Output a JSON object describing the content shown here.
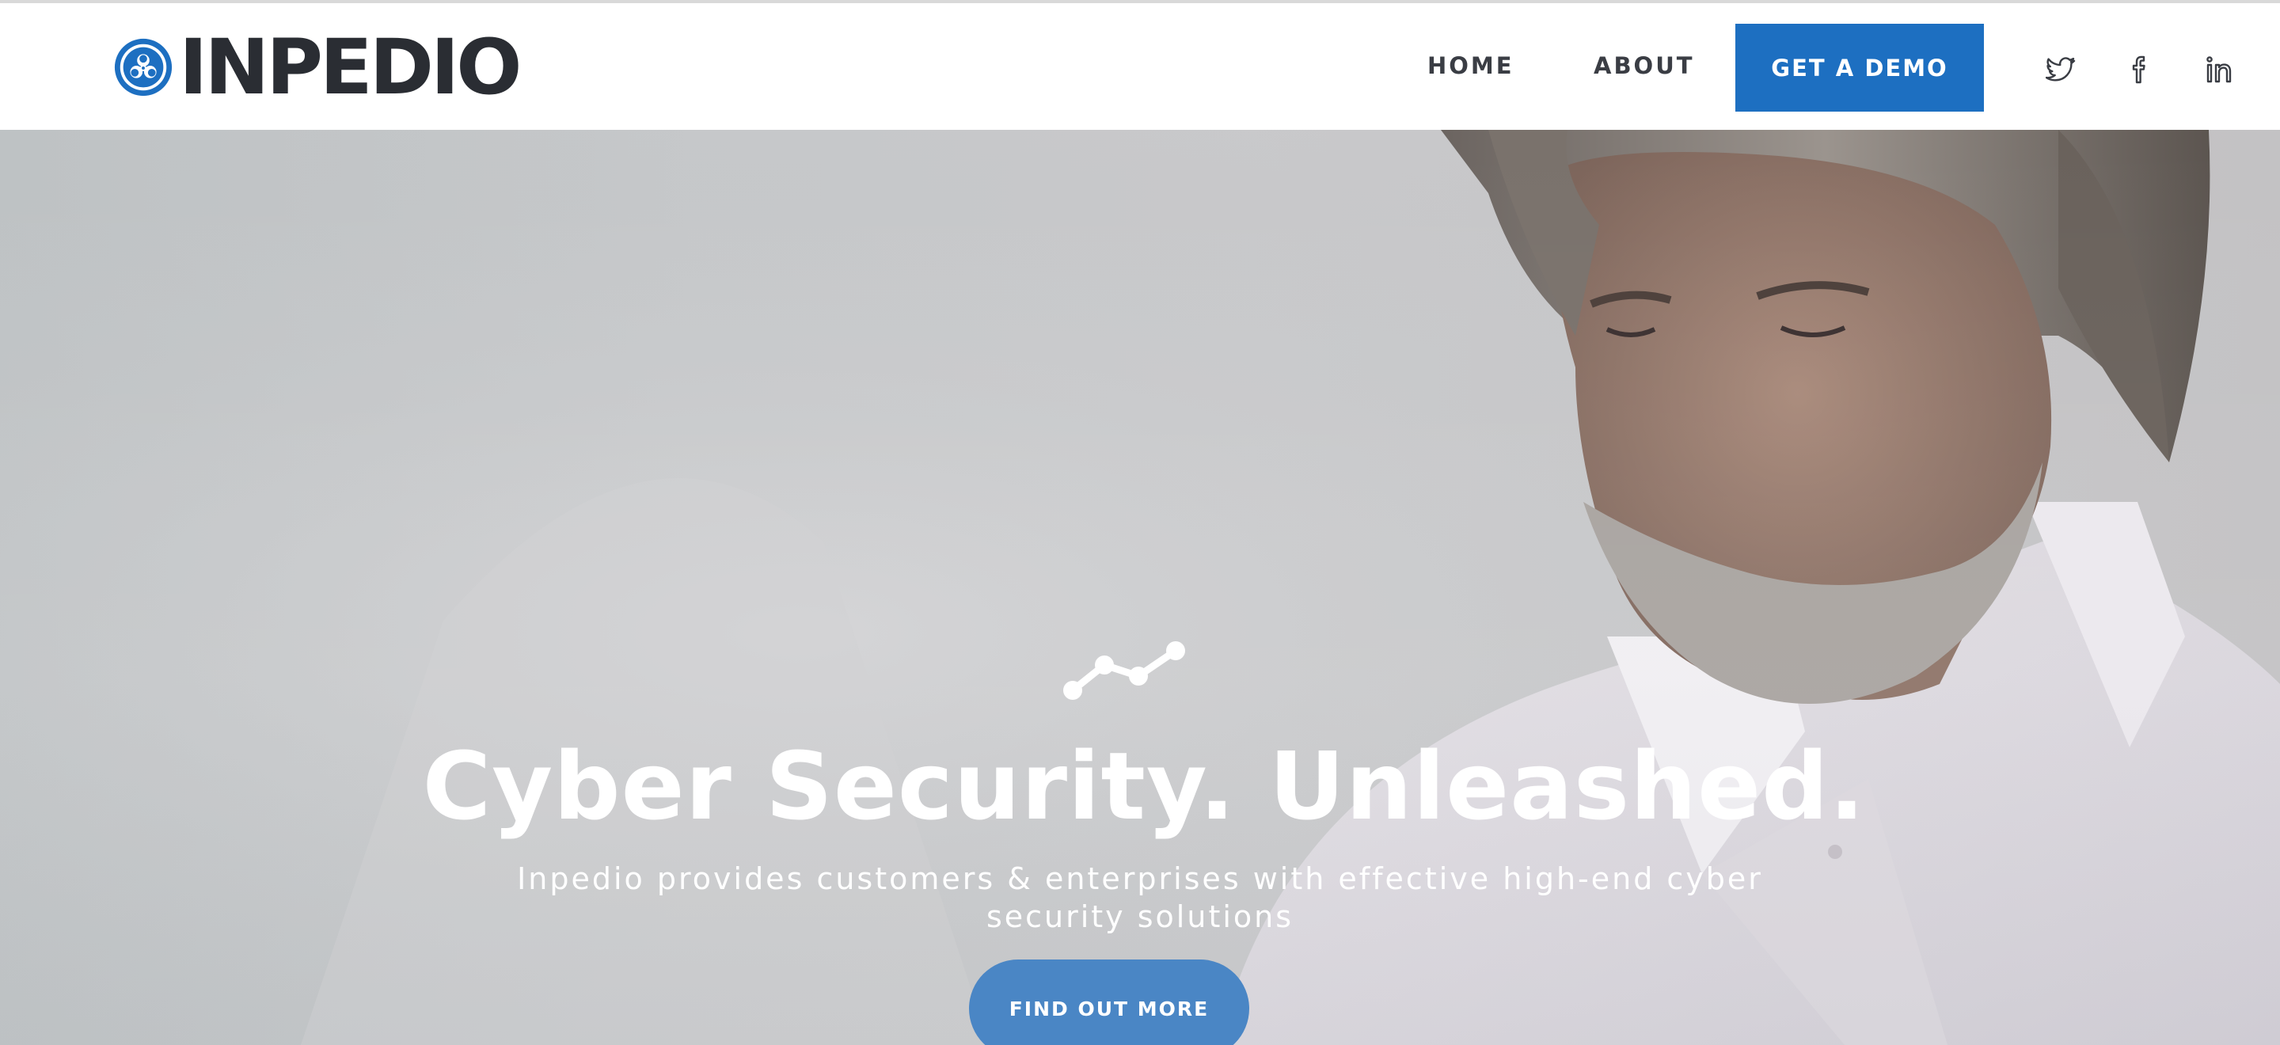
{
  "header": {
    "logo_text": "INPEDIO",
    "nav": {
      "home": "HOME",
      "about": "ABOUT"
    },
    "demo_button": "GET A DEMO",
    "social": [
      "twitter-icon",
      "facebook-icon",
      "linkedin-icon"
    ]
  },
  "hero": {
    "icon": "line-chart-icon",
    "title": "Cyber Security. Unleashed.",
    "subtitle": "Inpedio provides customers & enterprises with effective high-end cyber security solutions",
    "cta": "FIND OUT MORE"
  },
  "colors": {
    "brand_blue": "#1d6fc1",
    "cta_blue": "#4a86c5",
    "logo_dark": "#2a2d33"
  }
}
